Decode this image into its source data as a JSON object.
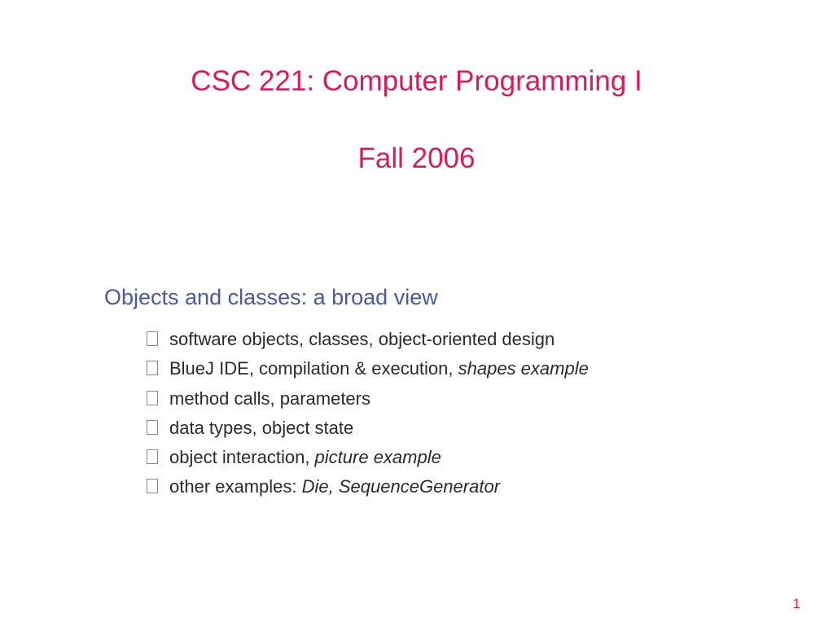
{
  "title": {
    "line1": "CSC 221: Computer Programming I",
    "line2": "Fall 2006"
  },
  "subtitle": "Objects and classes: a broad view",
  "bullets": [
    {
      "text": "software objects, classes, object-oriented design",
      "italic": ""
    },
    {
      "text": "BlueJ IDE, compilation & execution, ",
      "italic": "shapes example"
    },
    {
      "text": "method calls, parameters",
      "italic": ""
    },
    {
      "text": "data types, object state",
      "italic": ""
    },
    {
      "text": "object interaction, ",
      "italic": "picture example"
    },
    {
      "text": "other examples: ",
      "italic": "Die, SequenceGenerator"
    }
  ],
  "page_number": "1"
}
